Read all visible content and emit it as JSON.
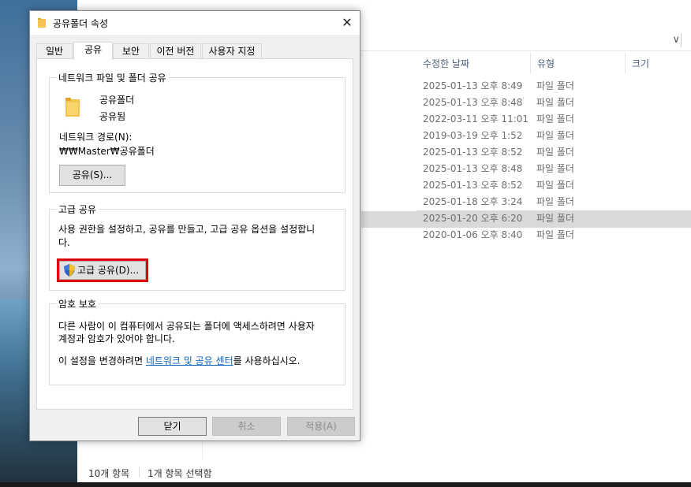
{
  "dialog": {
    "title": "공유폴더 속성",
    "close_label": "✕",
    "tabs": [
      {
        "label": "일반"
      },
      {
        "label": "공유"
      },
      {
        "label": "보안"
      },
      {
        "label": "이전 버전"
      },
      {
        "label": "사용자 지정"
      }
    ],
    "network_share": {
      "legend": "네트워크 파일 및 폴더 공유",
      "folder_name": "공유폴더",
      "share_status": "공유됨",
      "path_label": "네트워크 경로(N):",
      "path_value": "₩₩Master₩공유폴더",
      "share_button": "공유(S)..."
    },
    "advanced_share": {
      "legend": "고급 공유",
      "description_line1": "사용 권한을 설정하고, 공유를 만들고, 고급 공유 옵션을 설정합니",
      "description_line2": "다.",
      "button": "고급 공유(D)..."
    },
    "password": {
      "legend": "암호 보호",
      "text_line1": "다른 사람이 이 컴퓨터에서 공유되는 폴더에 액세스하려면 사용자",
      "text_line2": "계정과 암호가 있어야 합니다.",
      "text3_prefix": "이 설정을 변경하려면 ",
      "link": "네트워크 및 공유 센터",
      "text3_suffix": "를 사용하십시오."
    },
    "buttons": {
      "close": "닫기",
      "cancel": "취소",
      "apply": "적용(A)"
    }
  },
  "explorer": {
    "columns": [
      "수정한 날짜",
      "유형",
      "크기"
    ],
    "rows": [
      {
        "date": "2025-01-13 오후 8:49",
        "type": "파일 폴더"
      },
      {
        "date": "2025-01-13 오후 8:48",
        "type": "파일 폴더"
      },
      {
        "date": "2022-03-11 오후 11:01",
        "type": "파일 폴더"
      },
      {
        "date": "2019-03-19 오후 1:52",
        "type": "파일 폴더"
      },
      {
        "date": "2025-01-13 오후 8:52",
        "type": "파일 폴더"
      },
      {
        "date": "2025-01-13 오후 8:48",
        "type": "파일 폴더"
      },
      {
        "date": "2025-01-13 오후 8:52",
        "type": "파일 폴더"
      },
      {
        "date": "2025-01-18 오후 3:24",
        "type": "파일 폴더"
      },
      {
        "date": "2025-01-20 오후 6:20",
        "type": "파일 폴더"
      },
      {
        "date": "2020-01-06 오후 8:40",
        "type": "파일 폴더"
      }
    ],
    "status": {
      "item_count": "10개 항목",
      "selected": "1개 항목 선택함"
    },
    "address_chevron": "∨"
  },
  "colors": {
    "highlight": "#e0000c",
    "link": "#0b61b8",
    "folder": "#f3c44f"
  }
}
